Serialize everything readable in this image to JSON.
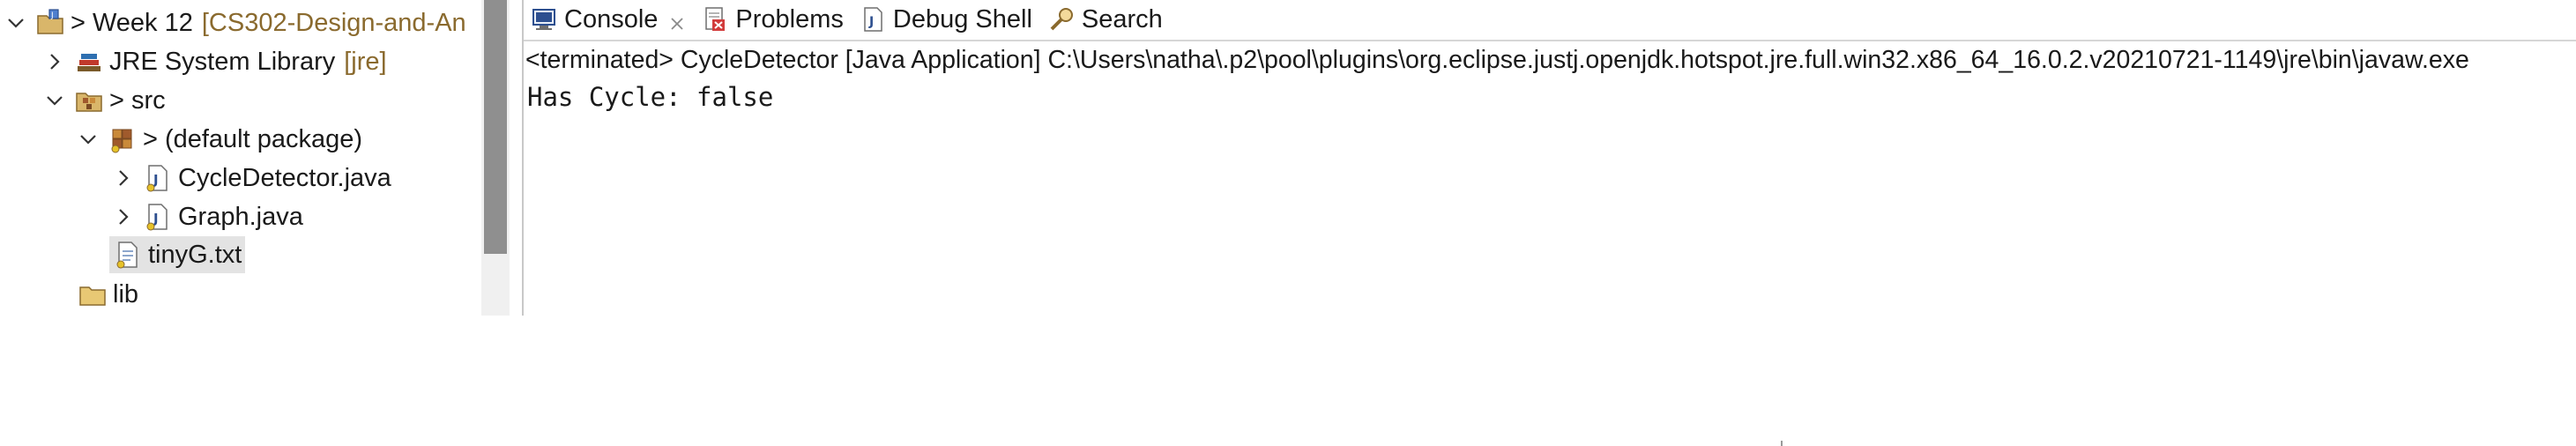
{
  "explorer": {
    "items": [
      {
        "label": "Week 12",
        "annotation": "[CS302-Design-and-An",
        "icon": "java-project-icon",
        "decorator": ">",
        "expanded": true
      },
      {
        "label": "JRE System Library",
        "annotation": "[jre]",
        "icon": "library-icon",
        "expanded": false
      },
      {
        "label": "src",
        "icon": "source-folder-icon",
        "decorator": ">",
        "expanded": true
      },
      {
        "label": "(default package)",
        "icon": "package-icon",
        "decorator": ">",
        "expanded": true
      },
      {
        "label": "CycleDetector.java",
        "icon": "java-file-icon",
        "expanded": false
      },
      {
        "label": "Graph.java",
        "icon": "java-file-icon",
        "expanded": false
      },
      {
        "label": "tinyG.txt",
        "icon": "text-file-icon",
        "selected": true
      },
      {
        "label": "lib",
        "icon": "folder-icon"
      }
    ]
  },
  "console_view": {
    "tabs": [
      {
        "label": "Console",
        "icon": "console-icon",
        "active": true,
        "closable": true
      },
      {
        "label": "Problems",
        "icon": "problems-icon"
      },
      {
        "label": "Debug Shell",
        "icon": "debug-shell-icon"
      },
      {
        "label": "Search",
        "icon": "search-icon"
      }
    ],
    "status": "<terminated> CycleDetector [Java Application] C:\\Users\\natha\\.p2\\pool\\plugins\\org.eclipse.justj.openjdk.hotspot.jre.full.win32.x86_64_16.0.2.v20210721-1149\\jre\\bin\\javaw.exe",
    "output": "Has Cycle: false"
  },
  "colors": {
    "annotation": "#8a6a2e",
    "selection": "#e3e3e3",
    "scroll_thumb": "#8f8f8f"
  }
}
